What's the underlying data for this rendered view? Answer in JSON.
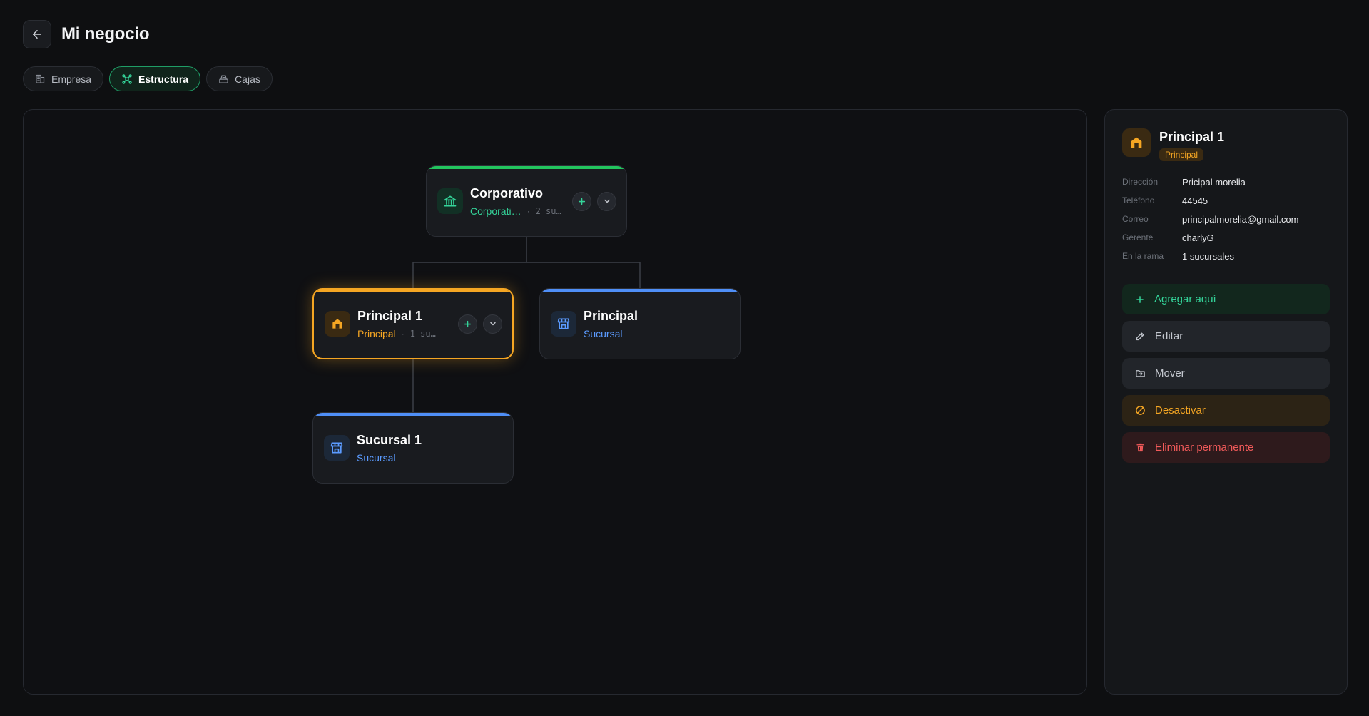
{
  "header": {
    "title": "Mi negocio"
  },
  "tabs": [
    {
      "label": "Empresa",
      "icon": "building-icon",
      "active": false
    },
    {
      "label": "Estructura",
      "icon": "network-icon",
      "active": true
    },
    {
      "label": "Cajas",
      "icon": "cash-register-icon",
      "active": false
    }
  ],
  "tree": {
    "corporativo": {
      "name": "Corporativo",
      "type": "Corporati…",
      "count": "2 su…",
      "accent": "#22c55e"
    },
    "principal1": {
      "name": "Principal 1",
      "type": "Principal",
      "count": "1 su…",
      "accent": "#f5a623"
    },
    "principal": {
      "name": "Principal",
      "type": "Sucursal",
      "accent": "#4f8ff7"
    },
    "sucursal1": {
      "name": "Sucursal 1",
      "type": "Sucursal",
      "accent": "#4f8ff7"
    }
  },
  "panel": {
    "title": "Principal 1",
    "badge": "Principal",
    "rows": [
      {
        "label": "Dirección",
        "value": "Pricipal morelia"
      },
      {
        "label": "Teléfono",
        "value": "44545"
      },
      {
        "label": "Correo",
        "value": "principalmorelia@gmail.com"
      },
      {
        "label": "Gerente",
        "value": "charlyG"
      },
      {
        "label": "En la rama",
        "value": "1 sucursales"
      }
    ],
    "actions": {
      "add": "Agregar aquí",
      "edit": "Editar",
      "move": "Mover",
      "deactivate": "Desactivar",
      "delete": "Eliminar permanente"
    }
  }
}
